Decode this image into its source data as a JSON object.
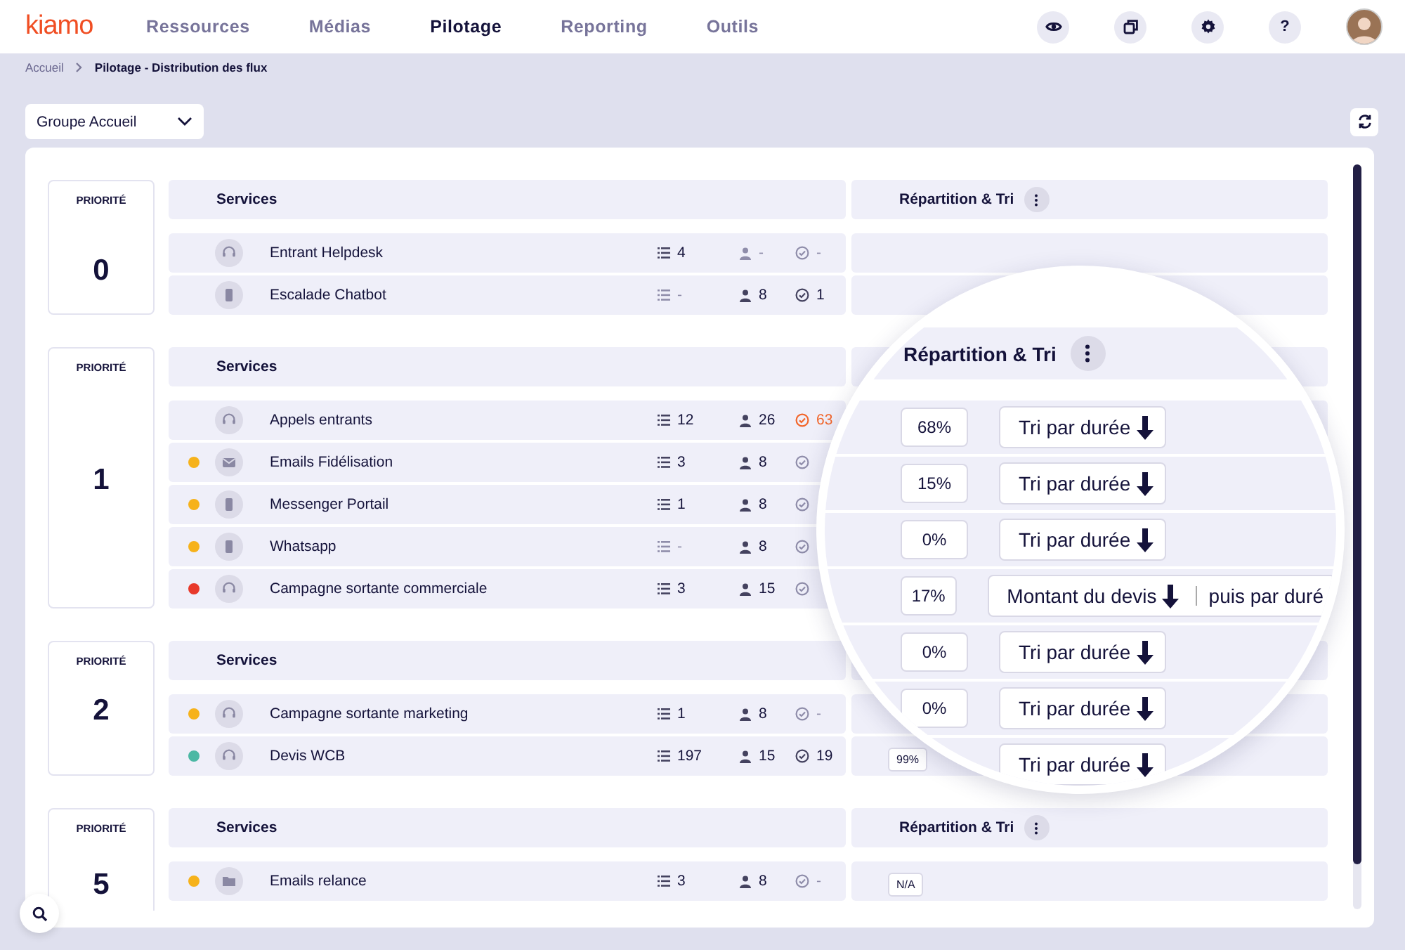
{
  "logo": "kiamo",
  "nav": [
    {
      "label": "Ressources",
      "selected": false
    },
    {
      "label": "Médias",
      "selected": false
    },
    {
      "label": "Pilotage",
      "selected": true
    },
    {
      "label": "Reporting",
      "selected": false
    },
    {
      "label": "Outils",
      "selected": false
    }
  ],
  "help_label": "?",
  "breadcrumb": [
    "Accueil",
    "Pilotage - Distribution des flux"
  ],
  "group_select": "Groupe Accueil",
  "groups": [
    {
      "priority_label": "PRIORITÉ",
      "priority": "0",
      "services_header": "Services",
      "dist_header": "Répartition & Tri",
      "rows": [
        {
          "name": "Entrant Helpdesk",
          "kind": "call",
          "queue": "4",
          "agents": "-",
          "handled": "-",
          "alert": false
        },
        {
          "name": "Escalade Chatbot",
          "kind": "chat",
          "queue": "-",
          "agents": "8",
          "handled": "1",
          "alert": false
        }
      ]
    },
    {
      "priority_label": "PRIORITÉ",
      "priority": "1",
      "services_header": "Services",
      "rows": [
        {
          "name": "Appels entrants",
          "kind": "call",
          "queue": "12",
          "agents": "26",
          "handled": "63",
          "alert": true
        },
        {
          "name": "Emails Fidélisation",
          "kind": "mail",
          "color": "#f6b21b",
          "queue": "3",
          "agents": "8",
          "alert": false
        },
        {
          "name": "Messenger Portail",
          "kind": "chat",
          "color": "#f6b21b",
          "queue": "1",
          "agents": "8",
          "alert": false
        },
        {
          "name": "Whatsapp",
          "kind": "chat",
          "color": "#f6b21b",
          "queue": "-",
          "agents": "8",
          "alert": false
        },
        {
          "name": "Campagne sortante commerciale",
          "kind": "call",
          "color": "#e8392b",
          "queue": "3",
          "agents": "15",
          "alert": false
        }
      ]
    },
    {
      "priority_label": "PRIORITÉ",
      "priority": "2",
      "services_header": "Services",
      "rows": [
        {
          "name": "Campagne sortante marketing",
          "kind": "call",
          "color": "#f6b21b",
          "queue": "1",
          "agents": "8",
          "handled": "-",
          "alert": false
        },
        {
          "name": "Devis WCB",
          "kind": "call",
          "color": "#4bb8a4",
          "queue": "197",
          "agents": "15",
          "handled": "19",
          "alert": false,
          "percent": "99%"
        }
      ]
    },
    {
      "priority_label": "PRIORITÉ",
      "priority": "5",
      "services_header": "Services",
      "dist_header": "Répartition & Tri",
      "rows": [
        {
          "name": "Emails relance",
          "kind": "folder",
          "color": "#f6b21b",
          "queue": "3",
          "agents": "8",
          "handled": "-",
          "alert": false,
          "percent": "N/A"
        }
      ]
    }
  ],
  "magnifier": {
    "header": "Répartition & Tri",
    "rows": [
      {
        "percent": "68%",
        "sort": "Tri par durée"
      },
      {
        "percent": "15%",
        "sort": "Tri par durée"
      },
      {
        "percent": "0%",
        "sort": "Tri par durée"
      },
      {
        "percent": "17%",
        "sort": "Montant du devis",
        "then": "puis par duré"
      },
      {
        "percent": "0%",
        "sort": "Tri par durée"
      },
      {
        "percent": "0%",
        "sort": "Tri par durée"
      },
      {
        "sort": "Tri par durée"
      }
    ]
  }
}
